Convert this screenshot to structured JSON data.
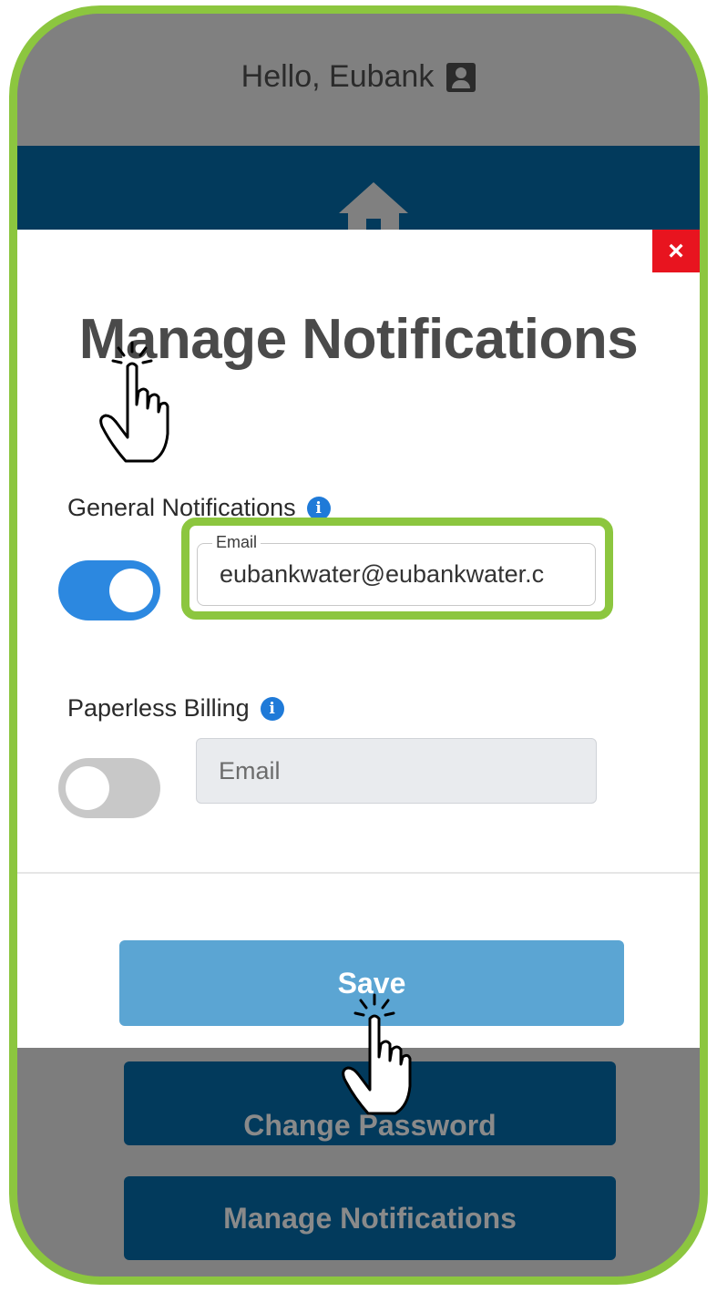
{
  "header": {
    "greeting": "Hello, Eubank",
    "user_icon": "account-box-icon"
  },
  "nav": {
    "home_icon": "home-icon",
    "color": "#023a5c"
  },
  "modal": {
    "close_label": "×",
    "title": "Manage Notifications",
    "general": {
      "label": "General Notifications",
      "info_icon": "i",
      "toggle_on": true,
      "email_legend": "Email",
      "email_value": "eubankwater@eubankwater.c"
    },
    "paperless": {
      "label": "Paperless Billing",
      "info_icon": "i",
      "toggle_on": false,
      "email_placeholder": "Email"
    },
    "save_label": "Save"
  },
  "background": {
    "change_password_label": "Change Password",
    "manage_notifications_label": "Manage Notifications"
  },
  "colors": {
    "accent_green": "#8cc63f",
    "toggle_blue": "#2c88e0",
    "save_blue": "#5ba5d3",
    "close_red": "#e8141f"
  }
}
